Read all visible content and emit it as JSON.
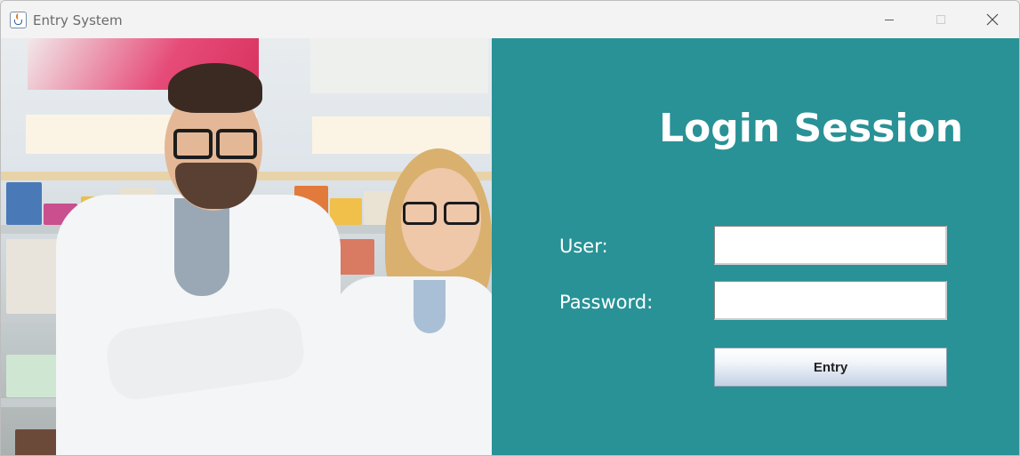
{
  "window": {
    "title": "Entry System",
    "app_icon": "java-cup-icon",
    "controls": {
      "minimize": "minimize-icon",
      "maximize": "maximize-icon",
      "close": "close-icon"
    }
  },
  "photo": {
    "description_icon": "pharmacists-photo"
  },
  "login": {
    "title": "Login Session",
    "user_label": "User:",
    "user_value": "",
    "password_label": "Password:",
    "password_value": "",
    "submit_label": "Entry"
  },
  "colors": {
    "panel_bg": "#289296",
    "text_on_panel": "#ffffff",
    "titlebar_bg": "#f3f3f3"
  }
}
